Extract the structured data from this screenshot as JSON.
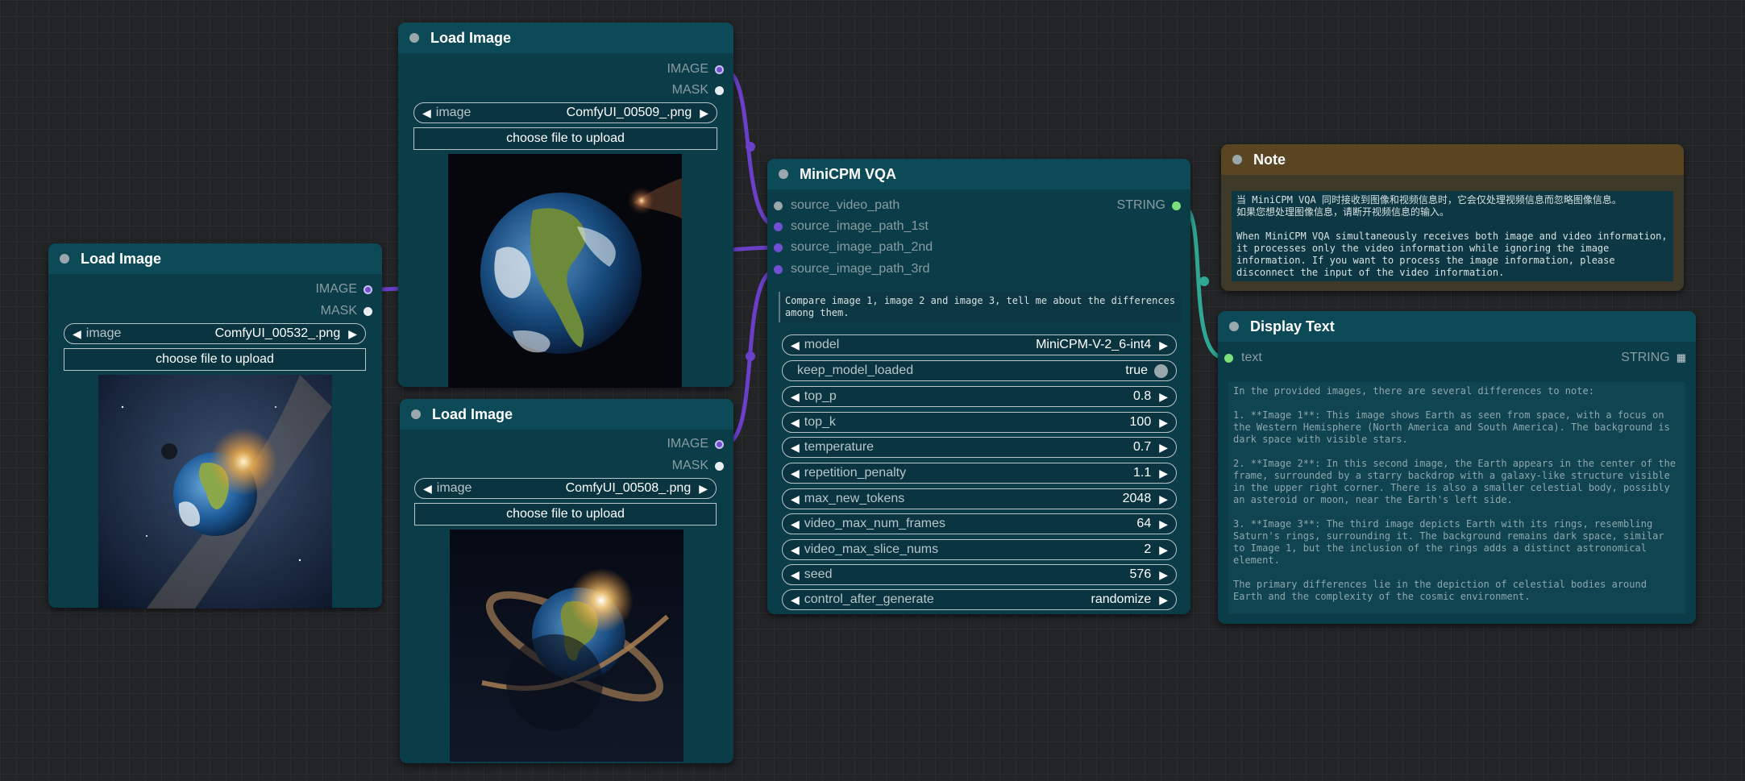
{
  "nodes": {
    "load1": {
      "title": "Load Image",
      "outputs": [
        "IMAGE",
        "MASK"
      ],
      "image_label": "image",
      "image_value": "ComfyUI_00532_.png",
      "upload_label": "choose file to upload"
    },
    "load2": {
      "title": "Load Image",
      "outputs": [
        "IMAGE",
        "MASK"
      ],
      "image_label": "image",
      "image_value": "ComfyUI_00509_.png",
      "upload_label": "choose file to upload"
    },
    "load3": {
      "title": "Load Image",
      "outputs": [
        "IMAGE",
        "MASK"
      ],
      "image_label": "image",
      "image_value": "ComfyUI_00508_.png",
      "upload_label": "choose file to upload"
    },
    "vqa": {
      "title": "MiniCPM VQA",
      "inputs": [
        "source_video_path",
        "source_image_path_1st",
        "source_image_path_2nd",
        "source_image_path_3rd"
      ],
      "output": "STRING",
      "prompt": "Compare image 1, image 2 and image 3, tell me about the differences among them.",
      "widgets": [
        {
          "label": "model",
          "value": "MiniCPM-V-2_6-int4"
        },
        {
          "label": "keep_model_loaded",
          "value": "true"
        },
        {
          "label": "top_p",
          "value": "0.8"
        },
        {
          "label": "top_k",
          "value": "100"
        },
        {
          "label": "temperature",
          "value": "0.7"
        },
        {
          "label": "repetition_penalty",
          "value": "1.1"
        },
        {
          "label": "max_new_tokens",
          "value": "2048"
        },
        {
          "label": "video_max_num_frames",
          "value": "64"
        },
        {
          "label": "video_max_slice_nums",
          "value": "2"
        },
        {
          "label": "seed",
          "value": "576"
        },
        {
          "label": "control_after_generate",
          "value": "randomize"
        }
      ]
    },
    "note": {
      "title": "Note",
      "text": "当 MiniCPM VQA 同时接收到图像和视频信息时，它会仅处理视频信息而忽略图像信息。\n如果您想处理图像信息，请断开视频信息的输入。\n\nWhen MiniCPM VQA simultaneously receives both image and video information, it processes only the video information while ignoring the image information. If you want to process the image information, please disconnect the input of the video information."
    },
    "display": {
      "title": "Display Text",
      "input": "text",
      "output": "STRING",
      "text": "In the provided images, there are several differences to note:\n\n1. **Image 1**: This image shows Earth as seen from space, with a focus on the Western Hemisphere (North America and South America). The background is dark space with visible stars.\n\n2. **Image 2**: In this second image, the Earth appears in the center of the frame, surrounded by a starry backdrop with a galaxy-like structure visible in the upper right corner. There is also a smaller celestial body, possibly an asteroid or moon, near the Earth's left side.\n\n3. **Image 3**: The third image depicts Earth with its rings, resembling Saturn's rings, surrounding it. The background remains dark space, similar to Image 1, but the inclusion of the rings adds a distinct astronomical element.\n\nThe primary differences lie in the depiction of celestial bodies around Earth and the complexity of the cosmic environment."
    }
  },
  "colors": {
    "canvas": "#222426",
    "node_body": "#0b3d49",
    "node_header": "#0d4a58",
    "note_body": "#3e3928",
    "note_header": "#5a4523",
    "image_link": "#6a3fc9",
    "string_link": "#2ea895",
    "string_slot": "#7be07b"
  }
}
